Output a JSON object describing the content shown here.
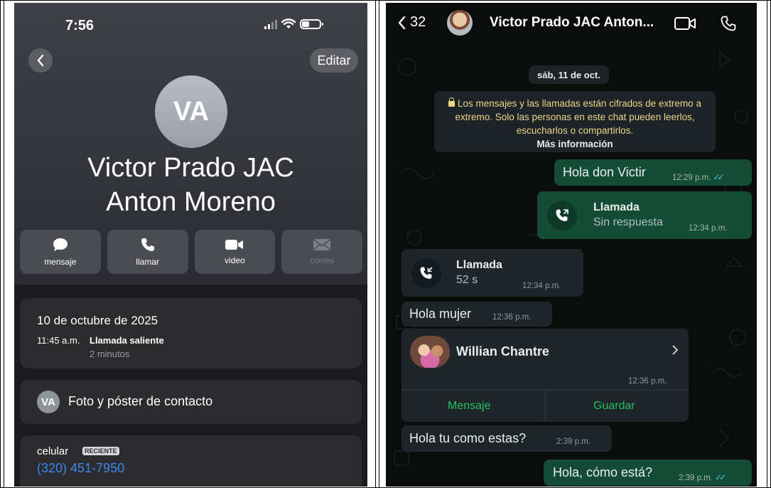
{
  "left": {
    "status_time": "7:56",
    "back_icon": "chevron-left-icon",
    "edit_label": "Editar",
    "avatar_initials": "VA",
    "contact_name_line1": "Victor Prado JAC",
    "contact_name_line2": "Anton Moreno",
    "actions": [
      {
        "label": "mensaje",
        "icon": "message-icon"
      },
      {
        "label": "llamar",
        "icon": "phone-icon"
      },
      {
        "label": "video",
        "icon": "video-icon"
      },
      {
        "label": "correo",
        "icon": "mail-icon"
      }
    ],
    "recent_call": {
      "date": "10 de octubre de 2025",
      "time": "11:45 a.m.",
      "type": "Llamada saliente",
      "duration": "2 minutos"
    },
    "photo_row": {
      "initials": "VA",
      "label": "Foto y póster de contacto"
    },
    "phone": {
      "label": "celular",
      "badge": "RECIENTE",
      "number": "(320) 451-7950"
    }
  },
  "right": {
    "header": {
      "back_count": "32",
      "title": "Victor Prado JAC  Anton...",
      "icons": [
        "video-call-icon",
        "voice-call-icon"
      ]
    },
    "date_pill": "sáb, 11 de oct.",
    "encryption_note": {
      "text": "Los mensajes y las llamadas están cifrados de extremo a extremo. Solo las personas en este chat pueden leerlos, escucharlos o compartirlos.",
      "link": "Más información"
    },
    "messages": {
      "m1": {
        "text": "Hola don Victir",
        "time": "12:29 p.m.",
        "ticks": "✓✓"
      },
      "call_out": {
        "title": "Llamada",
        "sub": "Sin respuesta",
        "time": "12:34 p.m."
      },
      "call_in": {
        "title": "Llamada",
        "sub": "52 s",
        "time": "12:34 p.m."
      },
      "m2": {
        "text": "Hola mujer",
        "time": "12:36 p.m."
      },
      "contact": {
        "name": "Willian Chantre",
        "time": "12:36 p.m.",
        "btn_message": "Mensaje",
        "btn_save": "Guardar"
      },
      "m3": {
        "text": "Hola tu como estas?",
        "time": "2:39 p.m."
      },
      "m4": {
        "text": "Hola, cómo está?",
        "time": "2:39 p.m.",
        "ticks": "✓✓"
      }
    },
    "colors": {
      "outgoing": "#144d37",
      "incoming": "#1f2528",
      "link_green": "#21c063",
      "read_ticks": "#53bdeb"
    }
  }
}
